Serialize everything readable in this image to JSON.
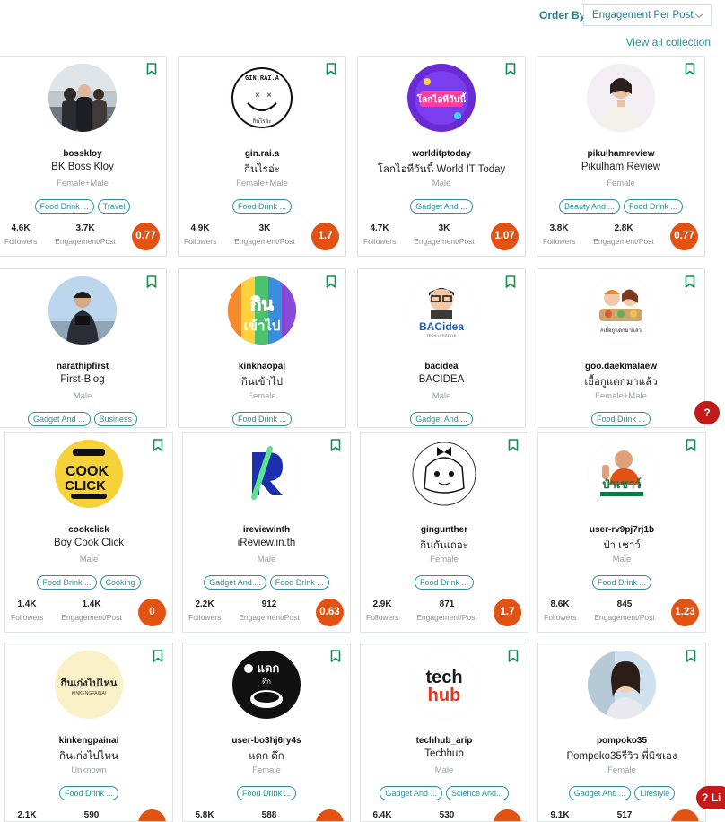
{
  "order": {
    "label": "Order By",
    "value": "Engagement Per Post",
    "chevron_icon": "chevron-down-icon"
  },
  "view_all": "View all collection",
  "colors": {
    "teal": "#2a8f9c",
    "score": "#e25213",
    "bookmark": "#0e8f4e"
  },
  "stat_labels": {
    "followers": "Followers",
    "engagement": "Engagement/Post"
  },
  "chat_button": {
    "left_label": "?",
    "right_label": "?",
    "right_text": "Li"
  },
  "cards": [
    {
      "handle": "bosskloy",
      "name": "BK Boss Kloy",
      "gender": "Female+Male",
      "tags": [
        "Food Drink ...",
        "Travel"
      ],
      "followers": "4.6K",
      "engagement": "3.7K",
      "score": "0.77"
    },
    {
      "handle": "gin.rai.a",
      "name": "กินไรอ่ะ",
      "gender": "Female+Male",
      "tags": [
        "Food Drink ..."
      ],
      "followers": "4.9K",
      "engagement": "3K",
      "score": "1.7"
    },
    {
      "handle": "worlditptoday",
      "name": "โลกไอทีวันนี้ World IT Today",
      "gender": "Male",
      "tags": [
        "Gadget And ..."
      ],
      "followers": "4.7K",
      "engagement": "3K",
      "score": "1.07"
    },
    {
      "handle": "pikulhamreview",
      "name": "Pikulham Review",
      "gender": "Female",
      "tags": [
        "Beauty And ...",
        "Food Drink ..."
      ],
      "followers": "3.8K",
      "engagement": "2.8K",
      "score": "0.77"
    },
    {
      "handle": "narathipfirst",
      "name": "First-Blog",
      "gender": "Male",
      "tags": [
        "Gadget And ...",
        "Business"
      ]
    },
    {
      "handle": "kinkhaopai",
      "name": "กินเข้าไป",
      "gender": "Female",
      "tags": [
        "Food Drink ..."
      ]
    },
    {
      "handle": "bacidea",
      "name": "BACIDEA",
      "gender": "Male",
      "tags": [
        "Gadget And ..."
      ]
    },
    {
      "handle": "goo.daekmalaew",
      "name": "เยื้อกูแดกมาแล้ว",
      "gender": "Female+Male",
      "tags": [
        "Food Drink ..."
      ]
    },
    {
      "handle": "cookclick",
      "name": "Boy Cook Click",
      "gender": "Male",
      "tags": [
        "Food Drink ...",
        "Cooking"
      ],
      "followers": "1.4K",
      "engagement": "1.4K",
      "score": "0"
    },
    {
      "handle": "ireviewinth",
      "name": "iReview.in.th",
      "gender": "Male",
      "tags": [
        "Gadget And ...",
        "Food Drink ..."
      ],
      "followers": "2.2K",
      "engagement": "912",
      "score": "0.63"
    },
    {
      "handle": "gingunther",
      "name": "กินกันเถอะ",
      "gender": "Female",
      "tags": [
        "Food Drink ..."
      ],
      "followers": "2.9K",
      "engagement": "871",
      "score": "1.7"
    },
    {
      "handle": "user-rv9pj7rj1b",
      "name": "ป๋า เชาว์",
      "gender": "Male",
      "tags": [
        "Food Drink ..."
      ],
      "followers": "8.6K",
      "engagement": "845",
      "score": "1.23"
    },
    {
      "handle": "kinkengpainai",
      "name": "กินเก่งไปไหน",
      "gender": "Unknown",
      "tags": [
        "Food Drink ..."
      ],
      "followers": "2.1K",
      "engagement": "590"
    },
    {
      "handle": "user-bo3hj6ry4s",
      "name": "แดก ดึก",
      "gender": "Female",
      "tags": [
        "Food Drink ..."
      ],
      "followers": "5.8K",
      "engagement": "588"
    },
    {
      "handle": "techhub_arip",
      "name": "Techhub",
      "gender": "Male",
      "tags": [
        "Gadget And ...",
        "Science And..."
      ],
      "followers": "6.4K",
      "engagement": "530"
    },
    {
      "handle": "pompoko35",
      "name": "Pompoko35รีวิว พี่มิชเอง",
      "gender": "Female",
      "tags": [
        "Gadget And ...",
        "Lifestyle"
      ],
      "followers": "9.1K",
      "engagement": "517"
    }
  ],
  "avatars": {
    "gin_text": "GIN.RAI.A",
    "gin_sub": "กินไรอ่ะ",
    "world_text": "โลกไอทีวันนี้",
    "kinkhao_top": "กิน",
    "kinkhao_bottom": "เข้าไป",
    "bac_text": "BACidea",
    "bac_sub": "TECH LIFESTYLE",
    "goo_text": "#เยื้อกูแดกมาแล้ว",
    "cook_top": "COOK",
    "cook_bottom": "CLICK",
    "pa_text": "ป๋าเชาว์",
    "kk_text": "กินเก่งไปไหน",
    "kk_sub": "KINKENGPAINAI",
    "daek_text": "แดก",
    "daek_sub": "ดึก",
    "tech_top": "tech",
    "tech_bottom": "hub"
  }
}
